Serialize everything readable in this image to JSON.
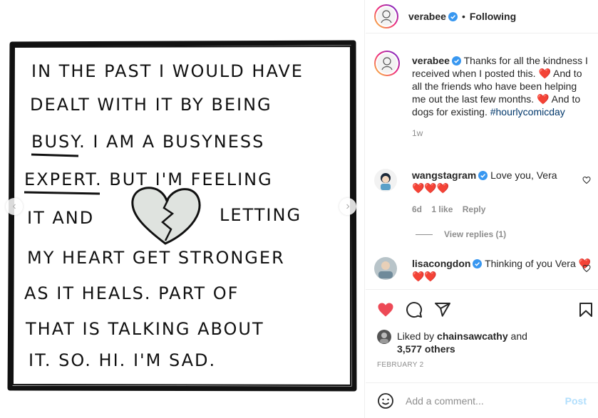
{
  "post": {
    "author": "verabee",
    "follow_status": "Following",
    "separator": "•",
    "caption_author": "verabee",
    "caption_text_1": "Thanks for all the kindness I received when I posted this.",
    "caption_text_2": "And to all the friends who have been helping me out the last few months.",
    "caption_text_3": "And to dogs for existing.",
    "hashtag": "#hourlycomicday",
    "caption_time": "1w",
    "date": "FEBRUARY 2",
    "liked_by_prefix": "Liked by",
    "liked_by_user": "chainsawcathy",
    "liked_by_suffix": "and",
    "likes_count": "3,577 others",
    "comment_placeholder": "Add a comment...",
    "post_label": "Post"
  },
  "comic_lines": [
    "IN THE PAST I WOULD HAVE",
    "DEALT WITH IT BY BEING",
    "BUSY.  I  AM A BUSYNESS",
    "EXPERT.  BUT  I'M FEELING",
    "IT AND",
    "LETTING",
    "MY HEART   GET STRONGER",
    "AS IT HEALS. PART OF",
    "THAT IS    TALKING ABOUT",
    "IT.  SO.  HI.  I'M  SAD."
  ],
  "comments": [
    {
      "user": "wangstagram",
      "text": "Love you, Vera",
      "hearts": "❤️❤️❤️",
      "time": "6d",
      "likes": "1 like",
      "reply": "Reply",
      "view_replies": "View replies (1)"
    },
    {
      "user": "lisacongdon",
      "text": "Thinking of you Vera",
      "hearts": "❤️❤️❤️"
    }
  ],
  "icons": {
    "like": "heart-filled-icon",
    "comment": "comment-icon",
    "share": "share-icon",
    "save": "bookmark-icon",
    "emoji": "emoji-icon",
    "verified": "verified-badge-icon"
  },
  "colors": {
    "like_red": "#ed4956",
    "verified_blue": "#3897f0",
    "link_blue": "#00376b",
    "post_button": "#b2dffc"
  }
}
